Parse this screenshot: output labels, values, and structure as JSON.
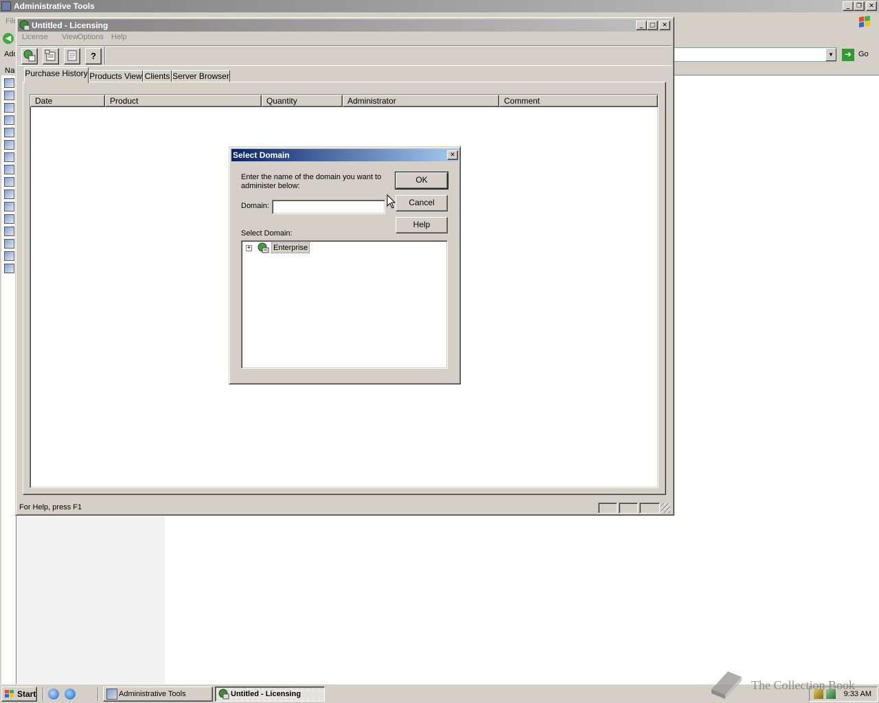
{
  "bg_window": {
    "title": "Administrative Tools",
    "menu_first": "File",
    "address_label": "Address",
    "go_label": "Go",
    "name_col": "Name"
  },
  "licensing": {
    "title": "Untitled - Licensing",
    "menu": [
      "License",
      "View",
      "Options",
      "Help"
    ],
    "toolbar_icons": [
      "select-domain-icon",
      "new-license-icon",
      "properties-icon",
      "help-icon"
    ],
    "tabs": [
      "Purchase History",
      "Products View",
      "Clients",
      "Server Browser"
    ],
    "active_tab": "Purchase History",
    "columns": [
      "Date",
      "Product",
      "Quantity",
      "Administrator",
      "Comment"
    ],
    "status": "For Help, press F1"
  },
  "dialog": {
    "title": "Select Domain",
    "prompt": "Enter the name of the domain you want to administer below:",
    "domain_label": "Domain:",
    "domain_value": "",
    "select_label": "Select Domain:",
    "tree_root": "Enterprise",
    "buttons": {
      "ok": "OK",
      "cancel": "Cancel",
      "help": "Help"
    }
  },
  "taskbar": {
    "start": "Start",
    "items": [
      "Administrative Tools",
      "Untitled - Licensing"
    ],
    "active_item": "Untitled - Licensing",
    "clock": "9:33 AM"
  },
  "watermark": "The Collection Book",
  "colors": {
    "face": "#d4d0c8",
    "active_title_start": "#0a246a",
    "active_title_end": "#a6caf0",
    "inactive_title": "#808080"
  }
}
